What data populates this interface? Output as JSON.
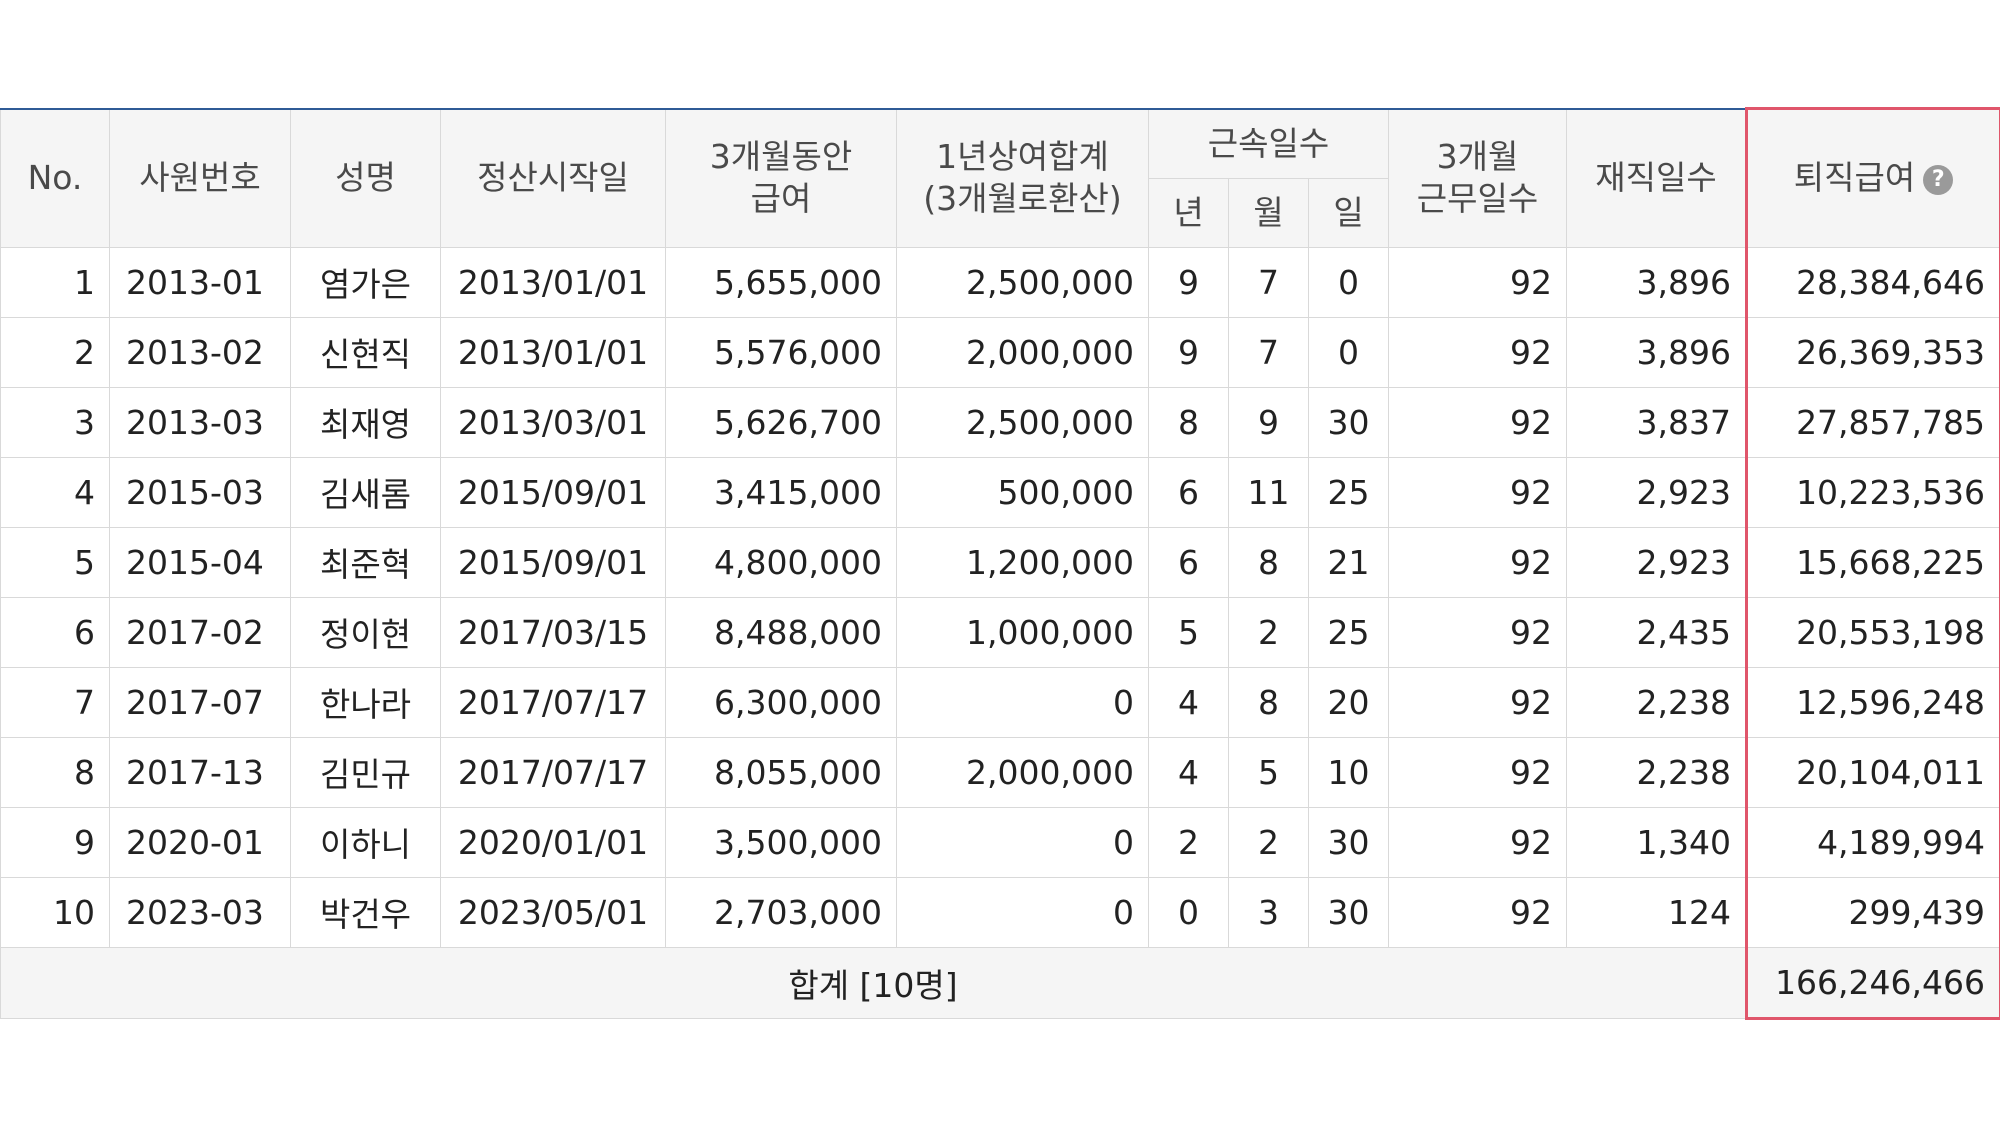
{
  "headers": {
    "no": "No.",
    "emp_id": "사원번호",
    "name": "성명",
    "start_date": "정산시작일",
    "pay3m_line1": "3개월동안",
    "pay3m_line2": "급여",
    "bonus_line1": "1년상여합계",
    "bonus_line2": "(3개월로환산)",
    "tenure": "근속일수",
    "tenure_year": "년",
    "tenure_month": "월",
    "tenure_day": "일",
    "work3m_line1": "3개월",
    "work3m_line2": "근무일수",
    "service_days": "재직일수",
    "severance": "퇴직급여",
    "help_icon": "?"
  },
  "rows": [
    {
      "no": "1",
      "emp_id": "2013-01",
      "name": "염가은",
      "start": "2013/01/01",
      "pay": "5,655,000",
      "bonus": "2,500,000",
      "y": "9",
      "m": "7",
      "d": "0",
      "work": "92",
      "service": "3,896",
      "sev": "28,384,646"
    },
    {
      "no": "2",
      "emp_id": "2013-02",
      "name": "신현직",
      "start": "2013/01/01",
      "pay": "5,576,000",
      "bonus": "2,000,000",
      "y": "9",
      "m": "7",
      "d": "0",
      "work": "92",
      "service": "3,896",
      "sev": "26,369,353"
    },
    {
      "no": "3",
      "emp_id": "2013-03",
      "name": "최재영",
      "start": "2013/03/01",
      "pay": "5,626,700",
      "bonus": "2,500,000",
      "y": "8",
      "m": "9",
      "d": "30",
      "work": "92",
      "service": "3,837",
      "sev": "27,857,785"
    },
    {
      "no": "4",
      "emp_id": "2015-03",
      "name": "김새롬",
      "start": "2015/09/01",
      "pay": "3,415,000",
      "bonus": "500,000",
      "y": "6",
      "m": "11",
      "d": "25",
      "work": "92",
      "service": "2,923",
      "sev": "10,223,536"
    },
    {
      "no": "5",
      "emp_id": "2015-04",
      "name": "최준혁",
      "start": "2015/09/01",
      "pay": "4,800,000",
      "bonus": "1,200,000",
      "y": "6",
      "m": "8",
      "d": "21",
      "work": "92",
      "service": "2,923",
      "sev": "15,668,225"
    },
    {
      "no": "6",
      "emp_id": "2017-02",
      "name": "정이현",
      "start": "2017/03/15",
      "pay": "8,488,000",
      "bonus": "1,000,000",
      "y": "5",
      "m": "2",
      "d": "25",
      "work": "92",
      "service": "2,435",
      "sev": "20,553,198"
    },
    {
      "no": "7",
      "emp_id": "2017-07",
      "name": "한나라",
      "start": "2017/07/17",
      "pay": "6,300,000",
      "bonus": "0",
      "y": "4",
      "m": "8",
      "d": "20",
      "work": "92",
      "service": "2,238",
      "sev": "12,596,248"
    },
    {
      "no": "8",
      "emp_id": "2017-13",
      "name": "김민규",
      "start": "2017/07/17",
      "pay": "8,055,000",
      "bonus": "2,000,000",
      "y": "4",
      "m": "5",
      "d": "10",
      "work": "92",
      "service": "2,238",
      "sev": "20,104,011"
    },
    {
      "no": "9",
      "emp_id": "2020-01",
      "name": "이하니",
      "start": "2020/01/01",
      "pay": "3,500,000",
      "bonus": "0",
      "y": "2",
      "m": "2",
      "d": "30",
      "work": "92",
      "service": "1,340",
      "sev": "4,189,994"
    },
    {
      "no": "10",
      "emp_id": "2023-03",
      "name": "박건우",
      "start": "2023/05/01",
      "pay": "2,703,000",
      "bonus": "0",
      "y": "0",
      "m": "3",
      "d": "30",
      "work": "92",
      "service": "124",
      "sev": "299,439"
    }
  ],
  "footer": {
    "label": "합계 [10명]",
    "total": "166,246,466"
  },
  "colors": {
    "header_bg": "#f5f5f5",
    "top_border": "#2f5b96",
    "highlight": "#e0566b"
  }
}
